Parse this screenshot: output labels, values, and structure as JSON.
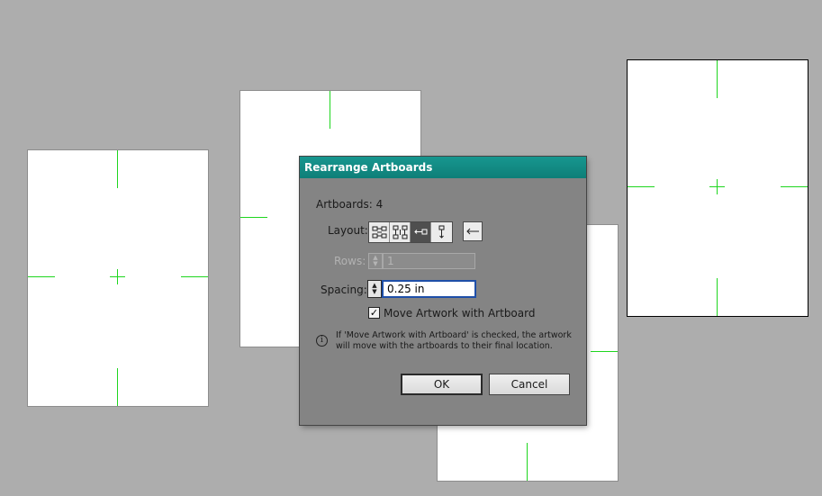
{
  "dialog": {
    "title": "Rearrange Artboards",
    "artboards_label": "Artboards: 4",
    "layout_label": "Layout:",
    "layout_options": [
      "grid-by-row-icon",
      "grid-by-column-icon",
      "arrange-by-row-icon",
      "arrange-by-column-icon"
    ],
    "layout_selected": "arrange-by-row-icon",
    "direction_icon": "left-arrow-icon",
    "rows_label": "Rows:",
    "rows_value": "1",
    "spacing_label": "Spacing:",
    "spacing_value": "0.25 in",
    "move_artwork_label": "Move Artwork with Artboard",
    "move_artwork_checked": true,
    "info_text": "If 'Move Artwork with Artboard' is checked, the artwork will move with the artboards to their final location.",
    "ok_label": "OK",
    "cancel_label": "Cancel"
  },
  "colors": {
    "canvas": "#adadad",
    "dialog_bg": "#848484",
    "titlebar": "#0e7f78",
    "crop_mark": "#1fd61f"
  }
}
